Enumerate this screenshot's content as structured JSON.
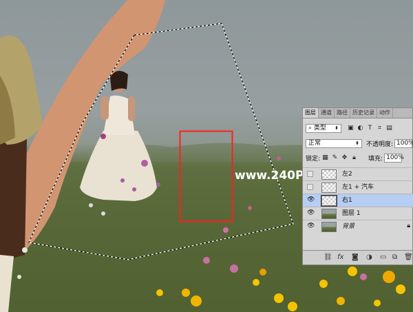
{
  "layers_panel": {
    "tabs": [
      "图层",
      "通道",
      "路径",
      "历史记录",
      "动作"
    ],
    "filter_kind": "类型",
    "blend_mode": "正常",
    "opacity_label": "不透明度:",
    "opacity_value": "100%",
    "lock_label": "锁定:",
    "fill_label": "填充:",
    "fill_value": "100%",
    "layers": [
      {
        "name": "左2",
        "visible": false,
        "selected": false
      },
      {
        "name": "左1 + 汽车",
        "visible": false,
        "selected": false
      },
      {
        "name": "右1",
        "visible": true,
        "selected": true
      },
      {
        "name": "图层 1",
        "visible": true,
        "selected": false
      },
      {
        "name": "背景",
        "visible": true,
        "selected": false,
        "locked": true
      }
    ],
    "footer_icons": [
      "link-icon",
      "fx-icon",
      "mask-icon",
      "adjustment-icon",
      "group-icon",
      "new-layer-icon",
      "delete-icon"
    ]
  },
  "watermark": "www.240PS.com",
  "colors": {
    "selection_rect": "#ff1e1e",
    "selected_layer": "#b7cdf2",
    "panel_bg": "#d6d6d6"
  }
}
